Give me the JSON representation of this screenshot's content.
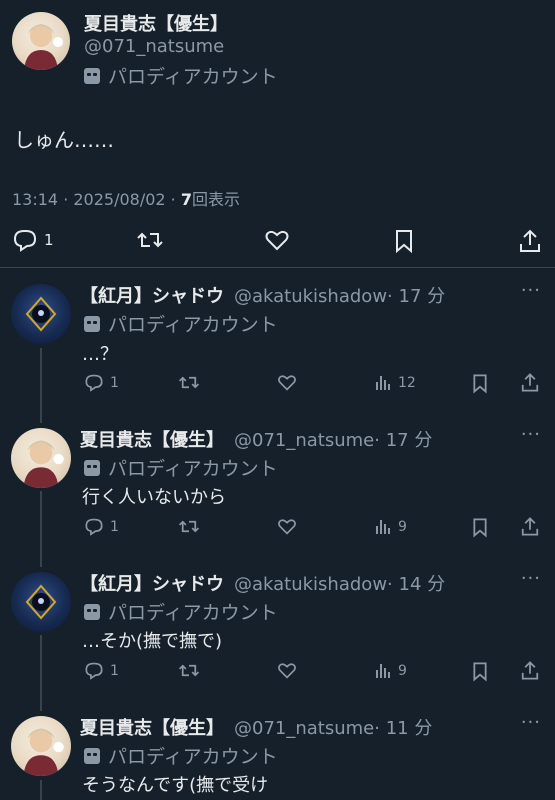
{
  "main_post": {
    "name": "夏目貴志【優生】",
    "handle": "@071_natsume",
    "badge": "パロディアカウント",
    "text": "しゅん……",
    "time": "13:14 · 2025/08/02 · ",
    "views_count": "7",
    "views_label": "回表示",
    "reply_count": "1"
  },
  "replies": [
    {
      "name": "【紅月】シャドウ",
      "handle": "@akatukishadow",
      "time": "· 17 分",
      "badge": "パロディアカウント",
      "text": "…？",
      "replies": "1",
      "views": "12"
    },
    {
      "name": "夏目貴志【優生】",
      "handle": "@071_natsume",
      "time": "· 17 分",
      "badge": "パロディアカウント",
      "text": "行く人いないから",
      "replies": "1",
      "views": "9"
    },
    {
      "name": "【紅月】シャドウ",
      "handle": "@akatukishadow",
      "time": "· 14 分",
      "badge": "パロディアカウント",
      "text": "…そか(撫で撫で)",
      "replies": "1",
      "views": "9"
    },
    {
      "name": "夏目貴志【優生】",
      "handle": "@071_natsume",
      "time": "· 11 分",
      "badge": "パロディアカウント",
      "text": "そうなんです(撫で受け"
    }
  ],
  "icons": [
    "reply-icon",
    "retweet-icon",
    "like-icon",
    "bookmark-icon",
    "share-icon",
    "views-icon",
    "more-icon",
    "parody-mask-icon"
  ]
}
